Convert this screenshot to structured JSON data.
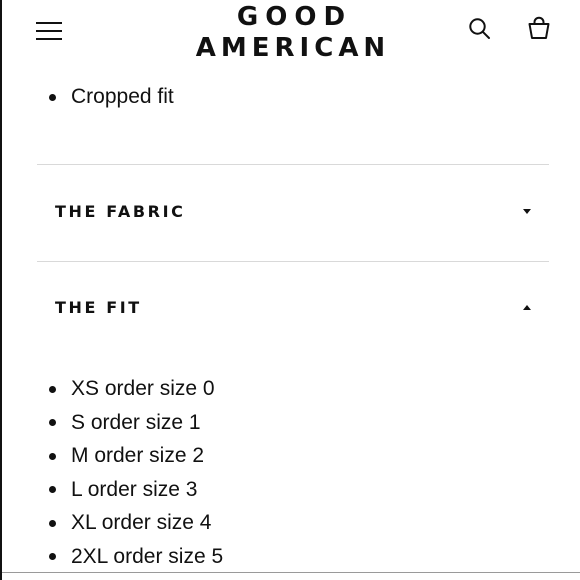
{
  "brand": {
    "line1": "GOOD",
    "line2": "AMERICAN"
  },
  "icons": {
    "menu": "hamburger-menu-icon",
    "search": "search-icon",
    "bag": "shopping-bag-icon"
  },
  "details_list": [
    "Cropped fit"
  ],
  "accordions": [
    {
      "title": "THE FABRIC",
      "state": "collapsed"
    },
    {
      "title": "THE FIT",
      "state": "expanded"
    }
  ],
  "fit_sizes": [
    "XS order size 0",
    "S order size 1",
    "M order size 2",
    "L order size 3",
    "XL order size 4",
    "2XL order size 5"
  ],
  "colors": {
    "text": "#111111",
    "divider": "#d9d9d9",
    "background": "#ffffff"
  }
}
